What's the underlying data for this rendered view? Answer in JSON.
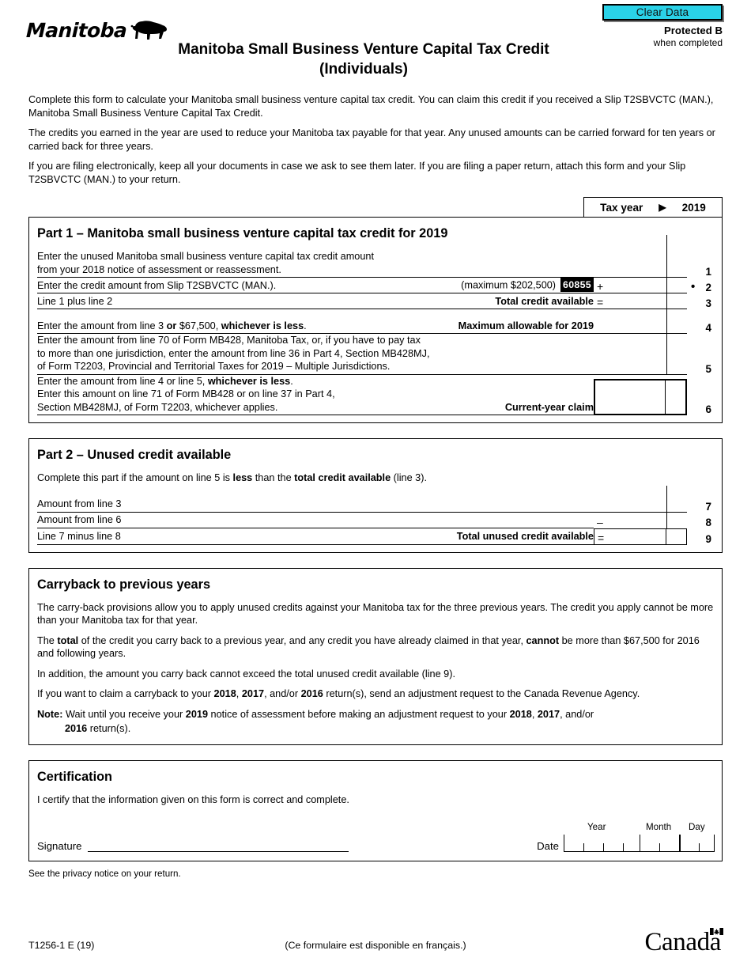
{
  "header": {
    "clear_data_label": "Clear Data",
    "protected_main": "Protected B",
    "protected_sub": "when completed",
    "logo_word": "Manitoba",
    "title_line1": "Manitoba Small Business Venture Capital Tax Credit",
    "title_line2": "(Individuals)"
  },
  "intro": {
    "p1": "Complete this form to calculate your Manitoba small business venture capital tax credit. You can claim this credit if you received a Slip T2SBVCTC (MAN.), Manitoba Small Business Venture Capital Tax Credit.",
    "p2": "The credits you earned in the year are used to reduce your Manitoba tax payable for that year. Any unused amounts can be carried forward for ten years or carried back for three years.",
    "p3": "If you are filing electronically, keep all your documents in case we ask to see them later. If you are filing a paper return, attach this form and your Slip T2SBVCTC (MAN.) to your return."
  },
  "taxyear": {
    "label": "Tax year",
    "arrow": "▶",
    "year": "2019"
  },
  "part1": {
    "heading": "Part 1 – Manitoba small business venture capital tax credit for 2019",
    "line1": {
      "text_a": "Enter the unused Manitoba small business venture capital tax credit amount",
      "text_b": "from your 2018 notice of assessment or reassessment.",
      "number": "1"
    },
    "line2": {
      "text": "Enter the credit amount from Slip T2SBVCTC (MAN.).",
      "maximum_note": "(maximum $202,500)",
      "field_code": "60855",
      "operator": "+",
      "number": "2"
    },
    "line3": {
      "text": "Line 1 plus line 2",
      "caption": "Total credit available",
      "operator": "=",
      "number": "3"
    },
    "line4": {
      "text_plain": "Enter the amount from line 3 ",
      "text_bold1": "or",
      "text_plain2": " $67,500, ",
      "text_bold2": "whichever is less",
      "text_plain3": ".",
      "caption": "Maximum allowable for 2019",
      "number": "4"
    },
    "line5": {
      "text_a": "Enter the amount from line 70 of Form MB428, Manitoba Tax, or, if you have to pay tax",
      "text_b": "to more than one jurisdiction, enter the amount from line 36 in Part 4, Section MB428MJ,",
      "text_c": "of Form T2203, Provincial and Territorial Taxes for 2019 – Multiple Jurisdictions.",
      "number": "5"
    },
    "line6": {
      "text_a_plain": "Enter the amount from line 4 or line 5, ",
      "text_a_bold": "whichever is less",
      "text_a_end": ".",
      "text_b": "Enter this amount on line 71 of Form MB428 or on line 37 in Part 4,",
      "text_c": "Section MB428MJ, of Form T2203, whichever applies.",
      "caption": "Current-year claim",
      "number": "6"
    }
  },
  "part2": {
    "heading": "Part 2 – Unused credit available",
    "intro_plain1": "Complete this part if the amount on line 5 is ",
    "intro_bold1": "less",
    "intro_plain2": " than the ",
    "intro_bold2": "total credit available",
    "intro_plain3": " (line 3).",
    "line7": {
      "text": "Amount from line 3",
      "number": "7"
    },
    "line8": {
      "text": "Amount from line 6",
      "operator": "–",
      "number": "8"
    },
    "line9": {
      "text": "Line 7 minus line 8",
      "caption": "Total unused credit available",
      "operator": "=",
      "number": "9"
    }
  },
  "carryback": {
    "heading": "Carryback to previous years",
    "p1": "The carry-back provisions allow you to apply unused credits against your Manitoba tax for the three previous years. The credit you apply cannot be more than your Manitoba tax for that year.",
    "p2_a": "The ",
    "p2_bold1": "total",
    "p2_b": " of the credit you carry back to a previous year, and any credit you have already claimed in that year, ",
    "p2_bold2": "cannot",
    "p2_c": " be more than $67,500 for 2016 and following years.",
    "p3": "In addition, the amount you carry back cannot exceed the total unused credit available (line 9).",
    "p4_a": "If you want to claim a carryback to your ",
    "p4_y1": "2018",
    "p4_b": ", ",
    "p4_y2": "2017",
    "p4_c": ", and/or ",
    "p4_y3": "2016",
    "p4_d": " return(s), send an adjustment request to the Canada Revenue Agency.",
    "note_label": "Note:",
    "note_a": " Wait until you receive your ",
    "note_y1": "2019",
    "note_b": " notice of assessment before making an adjustment request to your ",
    "note_y2": "2018",
    "note_c": ", ",
    "note_y3": "2017",
    "note_d": ", and/or",
    "note_e2": "2016",
    "note_f": " return(s)."
  },
  "certification": {
    "heading": "Certification",
    "statement": "I certify that the information given on this form is correct and complete.",
    "signature_label": "Signature",
    "date_label": "Date",
    "year_label": "Year",
    "month_label": "Month",
    "day_label": "Day"
  },
  "privacy_note": "See the privacy notice on your return.",
  "footer": {
    "form_code": "T1256-1 E (19)",
    "french_note": "(Ce formulaire est disponible en français.)",
    "canada_wordmark": "Canada"
  },
  "colors": {
    "clear_data_bg": "#2ad2e8",
    "flag_red": "#000000"
  }
}
